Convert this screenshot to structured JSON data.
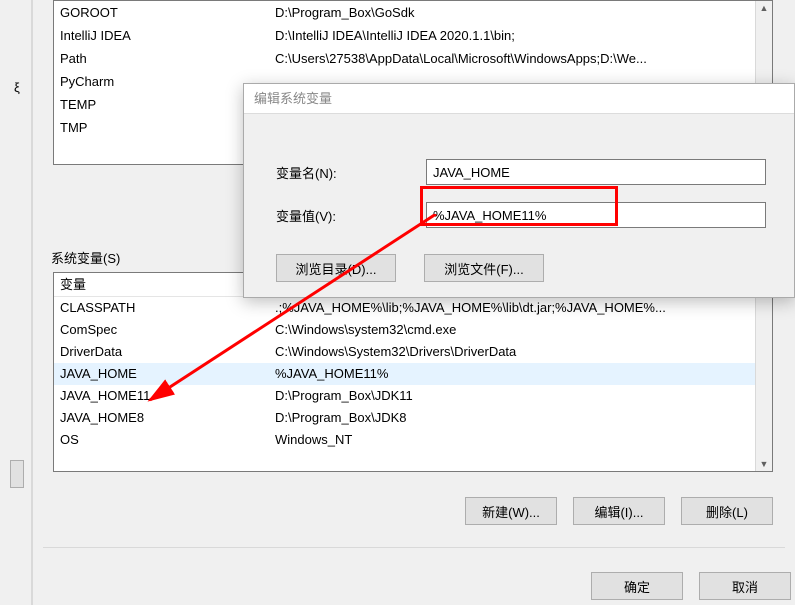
{
  "left_fragment": {
    "txt": "ξ"
  },
  "user_vars": {
    "rows": [
      {
        "name": "GOROOT",
        "value": "D:\\Program_Box\\GoSdk"
      },
      {
        "name": "IntelliJ IDEA",
        "value": "D:\\IntelliJ IDEA\\IntelliJ IDEA 2020.1.1\\bin;"
      },
      {
        "name": "Path",
        "value": "C:\\Users\\27538\\AppData\\Local\\Microsoft\\WindowsApps;D:\\We..."
      },
      {
        "name": "PyCharm",
        "value": ""
      },
      {
        "name": "TEMP",
        "value": ""
      },
      {
        "name": "TMP",
        "value": ""
      }
    ]
  },
  "section_label": "系统变量(S)",
  "sys_vars": {
    "header": "变量",
    "rows": [
      {
        "name": "CLASSPATH",
        "value": ".;%JAVA_HOME%\\lib;%JAVA_HOME%\\lib\\dt.jar;%JAVA_HOME%..."
      },
      {
        "name": "ComSpec",
        "value": "C:\\Windows\\system32\\cmd.exe"
      },
      {
        "name": "DriverData",
        "value": "C:\\Windows\\System32\\Drivers\\DriverData"
      },
      {
        "name": "JAVA_HOME",
        "value": "%JAVA_HOME11%",
        "selected": true
      },
      {
        "name": "JAVA_HOME11",
        "value": "D:\\Program_Box\\JDK11"
      },
      {
        "name": "JAVA_HOME8",
        "value": "D:\\Program_Box\\JDK8"
      },
      {
        "name": "OS",
        "value": "Windows_NT"
      }
    ]
  },
  "buttons": {
    "new": "新建(W)...",
    "edit": "编辑(I)...",
    "delete": "删除(L)",
    "ok": "确定",
    "cancel": "取消"
  },
  "edit_dialog": {
    "title": "编辑系统变量",
    "name_label": "变量名(N):",
    "value_label": "变量值(V):",
    "name_value": "JAVA_HOME",
    "value_value": "%JAVA_HOME11%",
    "browse_dir": "浏览目录(D)...",
    "browse_file": "浏览文件(F)..."
  }
}
